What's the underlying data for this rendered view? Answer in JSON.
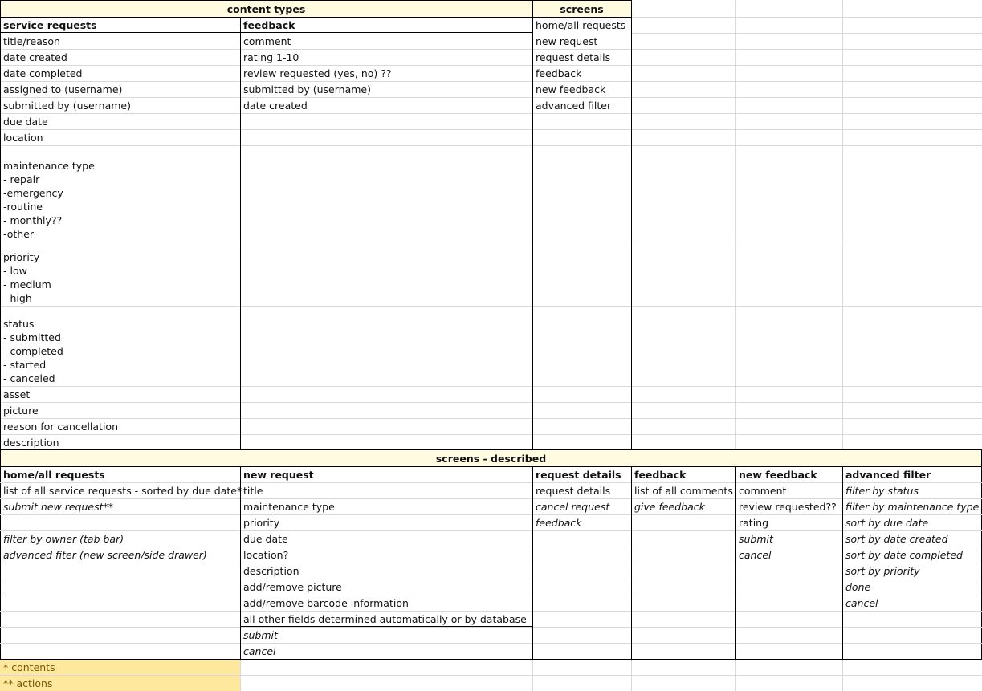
{
  "colors": {
    "header_fill": "#fffbe0",
    "legend_fill": "#fde89e",
    "grid": "#d9d9d9",
    "border": "#000000"
  },
  "top": {
    "group_content_types": "content types",
    "group_screens": "screens",
    "col_service_requests": "service requests",
    "col_feedback": "feedback",
    "service_requests": [
      "title/reason",
      "date created",
      "date completed",
      "assigned to (username)",
      "submitted by (username)",
      "due date",
      "location",
      "maintenance type\n- repair\n-emergency\n-routine\n- monthly??\n-other",
      "priority\n- low\n- medium\n- high",
      "status\n- submitted\n- completed\n- started\n- canceled",
      "asset",
      "picture",
      "reason for cancellation",
      "description"
    ],
    "feedback_fields": [
      "comment",
      "rating 1-10",
      "review requested (yes, no) ??",
      "submitted by (username)",
      "date created"
    ],
    "screens": [
      "home/all requests",
      "new request",
      "request details",
      "feedback",
      "new feedback",
      "advanced filter"
    ]
  },
  "described": {
    "title": "screens - described",
    "columns": [
      {
        "header": "home/all requests",
        "items": [
          "list of all service requests - sorted by due date*",
          "submit new request**",
          "",
          "filter by owner (tab bar)",
          "advanced fiter (new screen/side drawer)"
        ]
      },
      {
        "header": "new request",
        "items": [
          "title",
          "maintenance type",
          "priority",
          "due date",
          "location?",
          "description",
          "add/remove picture",
          "add/remove barcode information",
          "all other fields determined automatically or by database",
          "submit",
          "cancel"
        ]
      },
      {
        "header": "request details",
        "items": [
          "request details",
          "cancel request",
          "feedback"
        ]
      },
      {
        "header": "feedback",
        "items": [
          "list of all comments",
          "give feedback"
        ]
      },
      {
        "header": "new feedback",
        "items": [
          "comment",
          "review requested??",
          "rating",
          "submit",
          "cancel"
        ]
      },
      {
        "header": "advanced filter",
        "items": [
          "filter by status",
          "filter by maintenance type",
          "sort by due date",
          "sort by date created",
          "sort by date completed",
          "sort by priority",
          "done",
          "cancel"
        ]
      }
    ]
  },
  "legend": {
    "contents": "* contents",
    "actions": "** actions"
  }
}
